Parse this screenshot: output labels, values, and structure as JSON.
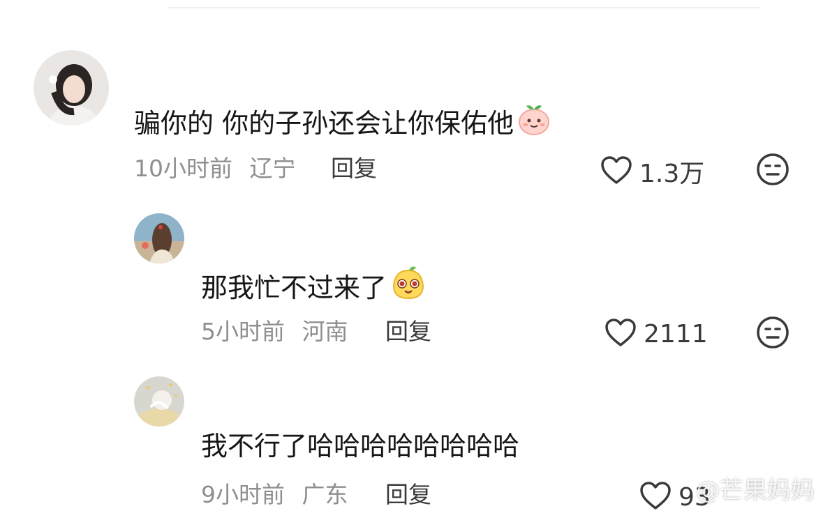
{
  "comments": [
    {
      "text": "骗你的 你的子孙还会让你保佑他",
      "time": "10小时前",
      "location": "辽宁",
      "reply_label": "回复",
      "likes": "1.3万",
      "emoji": "peach-face-emoji"
    },
    {
      "text": "那我忙不过来了",
      "time": "5小时前",
      "location": "河南",
      "reply_label": "回复",
      "likes": "2111",
      "emoji": "mango-face-emoji"
    },
    {
      "text": "我不行了哈哈哈哈哈哈哈哈",
      "time": "9小时前",
      "location": "广东",
      "reply_label": "回复",
      "likes": "93"
    }
  ],
  "watermark": "@芒果妈妈",
  "colors": {
    "text": "#161616",
    "meta": "#8f8f8f",
    "icon": "#3a3a3a"
  }
}
